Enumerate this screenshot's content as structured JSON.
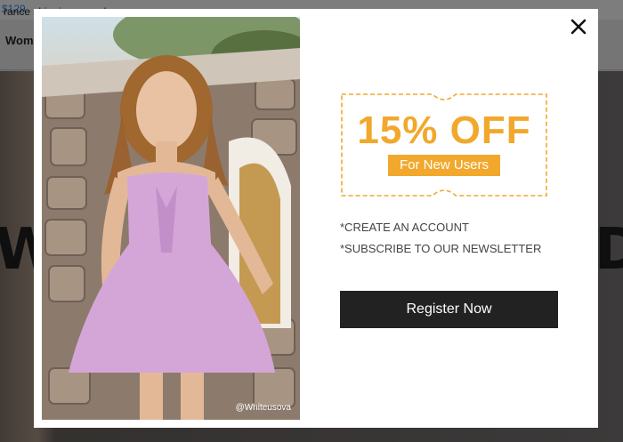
{
  "background": {
    "topbar_text": "rance shipping on orders over ",
    "topbar_amount": "$129",
    "nav_item": "Wome",
    "banner_letter_left": "W",
    "banner_letter_right": "D"
  },
  "modal": {
    "close_icon": "close-icon",
    "photo_credit": "@Whiteusova",
    "offer_title": "15% OFF",
    "offer_subtitle": "For New Users",
    "bullets": [
      "*CREATE AN ACCOUNT",
      "*SUBSCRIBE TO OUR NEWSLETTER"
    ],
    "cta_label": "Register Now",
    "accent_color": "#f2a82c",
    "button_color": "#222222"
  }
}
